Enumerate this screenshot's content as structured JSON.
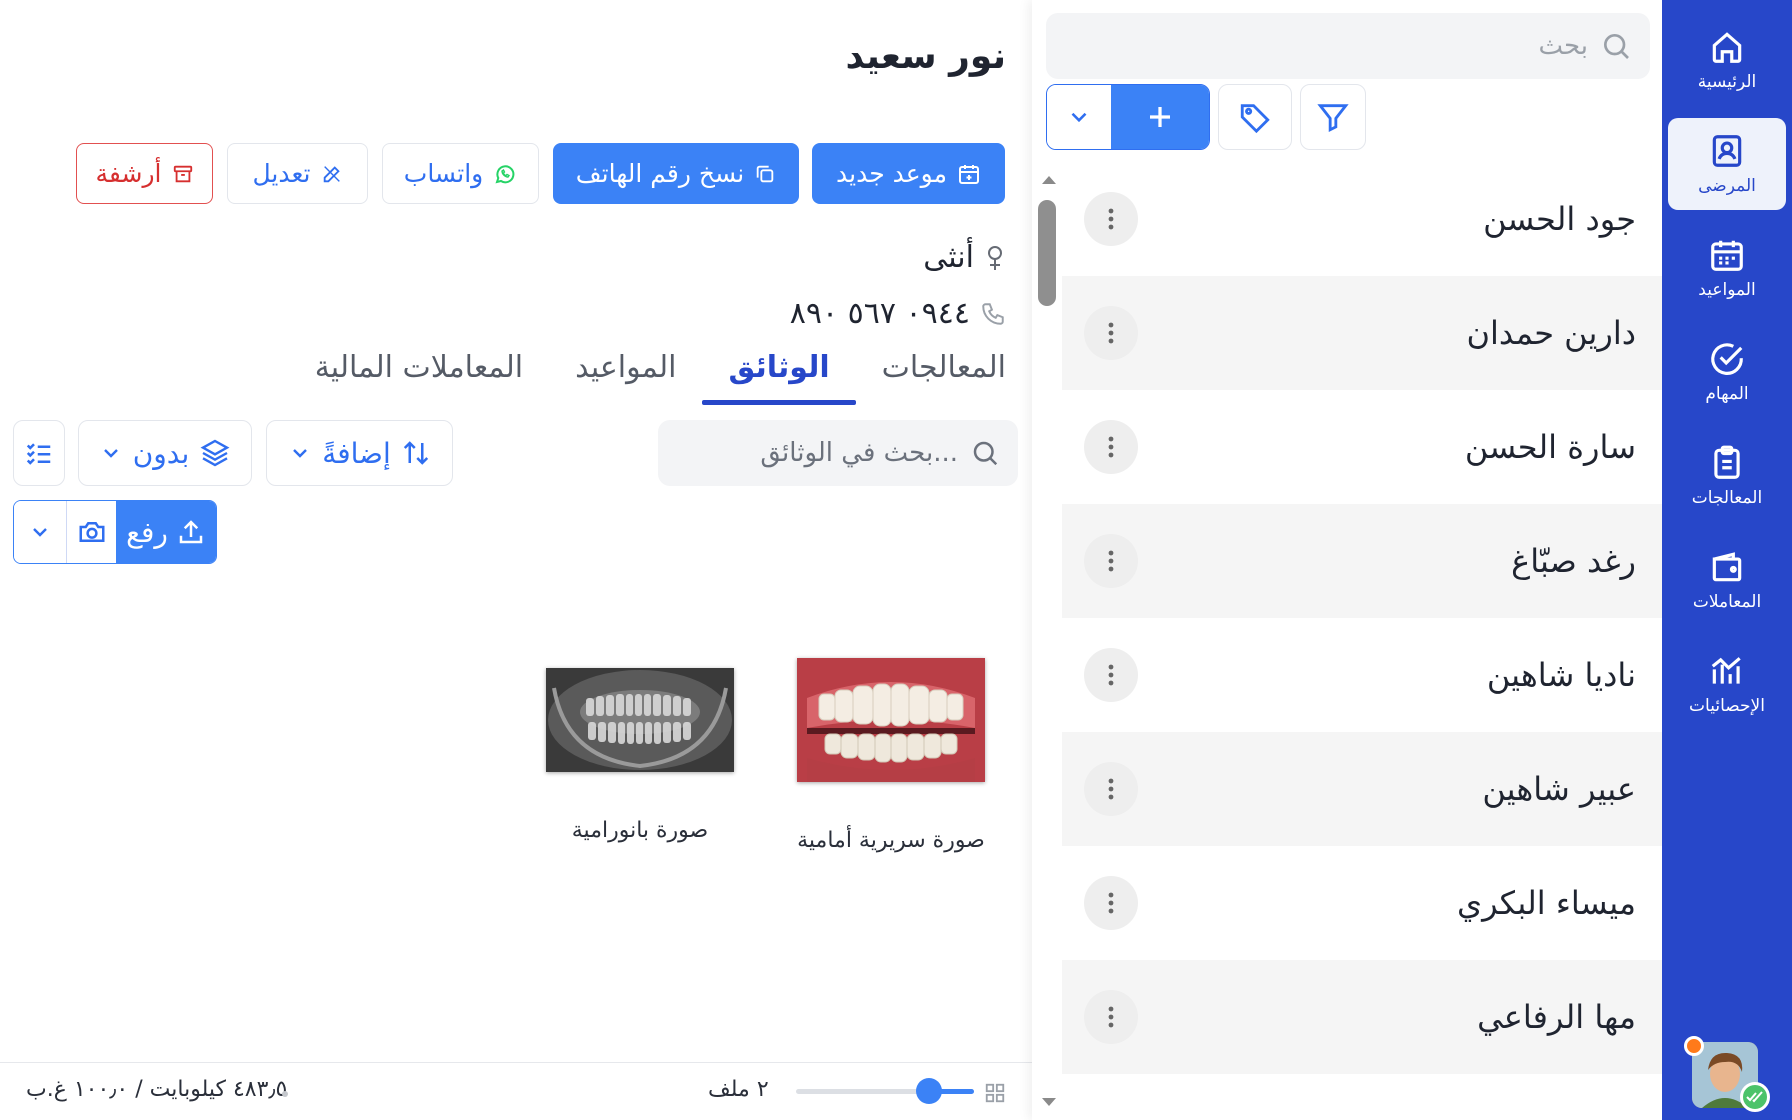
{
  "nav": {
    "items": [
      {
        "label": "الرئيسية",
        "icon": "home-icon"
      },
      {
        "label": "المرضى",
        "icon": "patient-card-icon",
        "active": true
      },
      {
        "label": "المواعيد",
        "icon": "calendar-icon"
      },
      {
        "label": "المهام",
        "icon": "check-circle-icon"
      },
      {
        "label": "المعالجات",
        "icon": "clipboard-icon"
      },
      {
        "label": "المعاملات",
        "icon": "wallet-icon"
      },
      {
        "label": "الإحصائيات",
        "icon": "stats-icon"
      }
    ]
  },
  "patients": {
    "search_placeholder": "بحث",
    "list": [
      {
        "name": "جود الحسن"
      },
      {
        "name": "دارين حمدان"
      },
      {
        "name": "سارة الحسن"
      },
      {
        "name": "رغد صبّاغ"
      },
      {
        "name": "ناديا شاهين"
      },
      {
        "name": "عبير شاهين"
      },
      {
        "name": "ميساء البكري"
      },
      {
        "name": "مها الرفاعي"
      }
    ]
  },
  "detail": {
    "patient_name": "نور سعيد",
    "actions": {
      "new_appointment": "موعد جديد",
      "copy_phone": "نسخ رقم الهاتف",
      "whatsapp": "واتساب",
      "edit": "تعديل",
      "archive": "أرشفة"
    },
    "gender": "أنثى",
    "phone": "٠٩٤٤ ٥٦٧ ٨٩٠",
    "tabs": [
      {
        "label": "المعالجات"
      },
      {
        "label": "الوثائق",
        "active": true
      },
      {
        "label": "المواعيد"
      },
      {
        "label": "المعاملات المالية"
      }
    ],
    "documents": {
      "search_placeholder": "بحث في الوثائق...",
      "sort_label": "إضافةً",
      "group_label": "بدون",
      "upload_label": "رفع",
      "files": [
        {
          "caption": "صورة سريرية أمامية",
          "kind": "clinical-photo"
        },
        {
          "caption": "صورة بانورامية",
          "kind": "panoramic-xray"
        }
      ],
      "file_count": "٢ ملف",
      "storage": "٤٨٣٫٥ كيلوبايت / ١٠٠٫٠ غ.ب",
      "zoom_fraction": 0.75
    }
  },
  "colors": {
    "rail": "#2747c9",
    "primary": "#3b82f6",
    "danger": "#d62f2f",
    "whatsapp": "#25d366"
  }
}
